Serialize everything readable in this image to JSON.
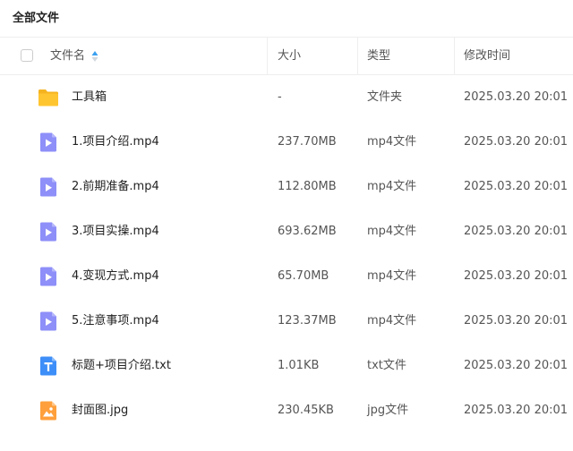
{
  "page": {
    "title": "全部文件"
  },
  "columns": {
    "name": "文件名",
    "size": "大小",
    "type": "类型",
    "mtime": "修改时间"
  },
  "icons": {
    "folder": "folder-icon",
    "video": "video-file-icon",
    "text": "text-file-icon",
    "image": "image-file-icon",
    "sort": "sort-ascending-icon"
  },
  "colors": {
    "folder": "#ffc530",
    "video": "#8e8ff8",
    "text": "#3d8ef8",
    "image": "#ffa03c",
    "sort_active": "#3aa0f0"
  },
  "files": [
    {
      "name": "工具箱",
      "size": "-",
      "type": "文件夹",
      "mtime": "2025.03.20 20:01",
      "icon": "folder"
    },
    {
      "name": "1.项目介绍.mp4",
      "size": "237.70MB",
      "type": "mp4文件",
      "mtime": "2025.03.20 20:01",
      "icon": "video"
    },
    {
      "name": "2.前期准备.mp4",
      "size": "112.80MB",
      "type": "mp4文件",
      "mtime": "2025.03.20 20:01",
      "icon": "video"
    },
    {
      "name": "3.项目实操.mp4",
      "size": "693.62MB",
      "type": "mp4文件",
      "mtime": "2025.03.20 20:01",
      "icon": "video"
    },
    {
      "name": "4.变现方式.mp4",
      "size": "65.70MB",
      "type": "mp4文件",
      "mtime": "2025.03.20 20:01",
      "icon": "video"
    },
    {
      "name": "5.注意事项.mp4",
      "size": "123.37MB",
      "type": "mp4文件",
      "mtime": "2025.03.20 20:01",
      "icon": "video"
    },
    {
      "name": "标题+项目介绍.txt",
      "size": "1.01KB",
      "type": "txt文件",
      "mtime": "2025.03.20 20:01",
      "icon": "text"
    },
    {
      "name": "封面图.jpg",
      "size": "230.45KB",
      "type": "jpg文件",
      "mtime": "2025.03.20 20:01",
      "icon": "image"
    }
  ]
}
